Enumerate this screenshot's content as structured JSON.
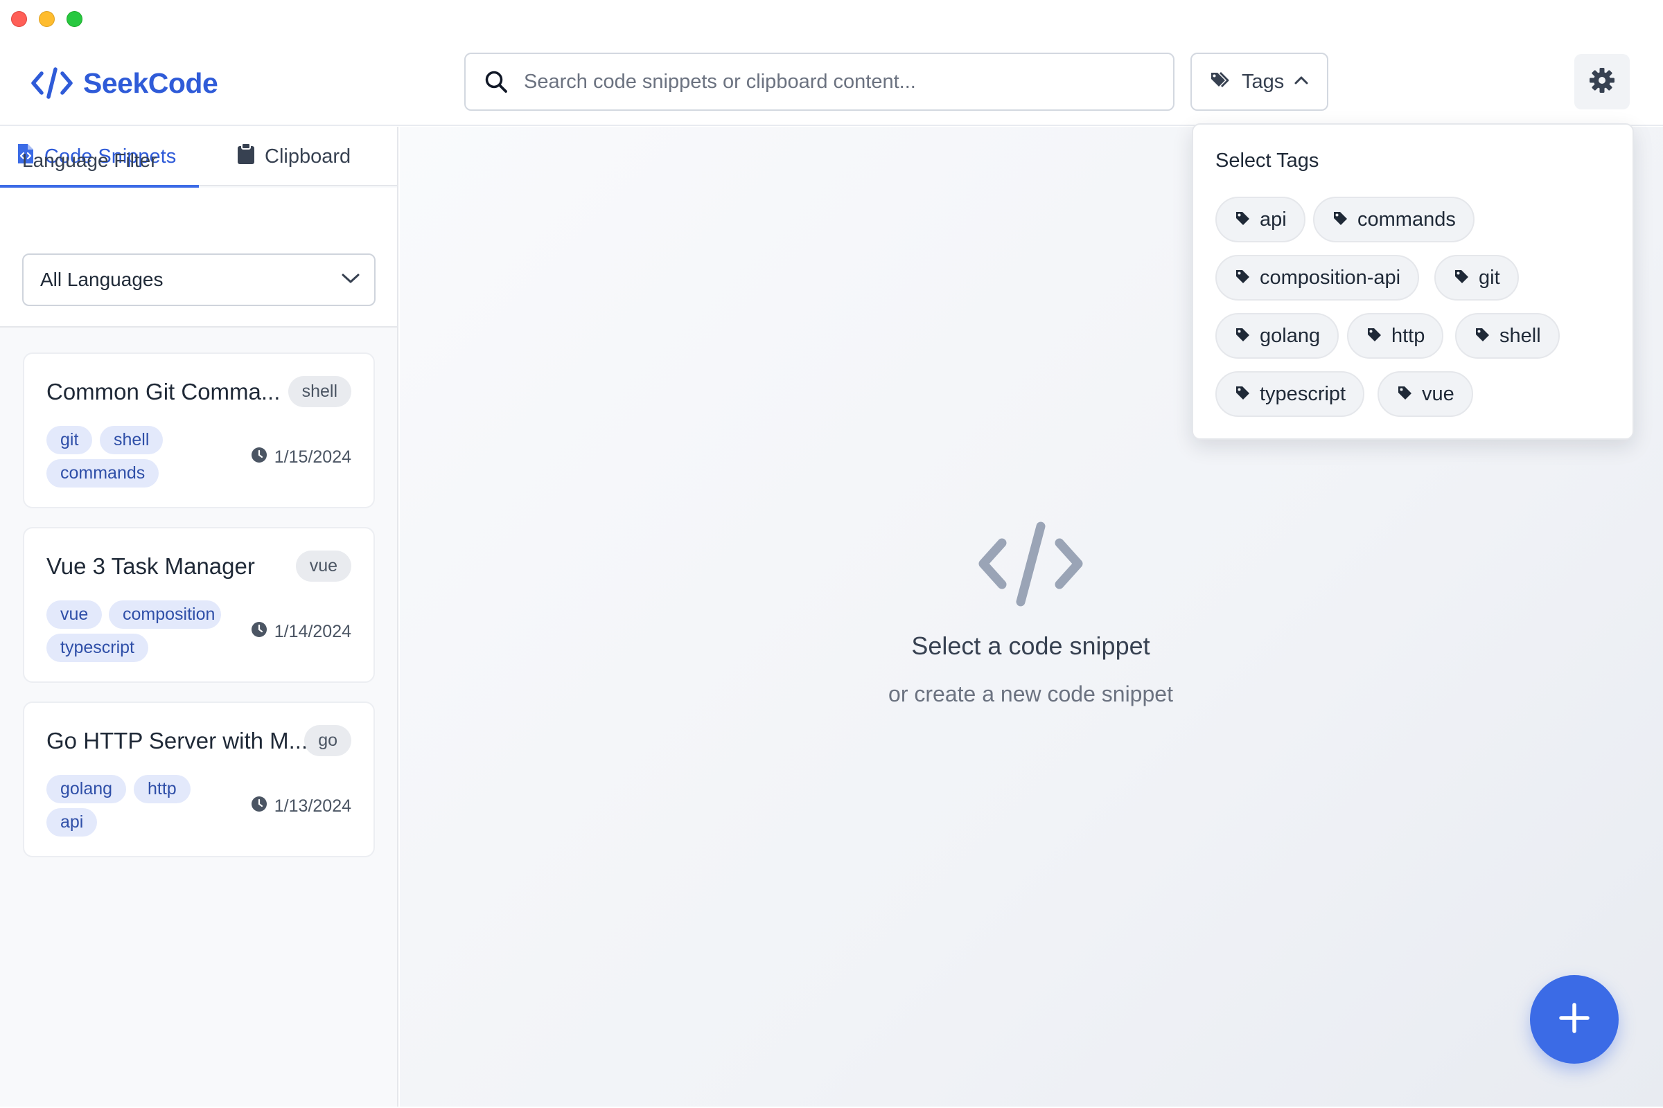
{
  "app": {
    "name": "SeekCode",
    "brand_color": "#2f5bd8",
    "accent_color": "#3b6be6"
  },
  "header": {
    "search": {
      "placeholder": "Search code snippets or clipboard content...",
      "value": "",
      "icon": "search-icon"
    },
    "tags_button": {
      "label": "Tags",
      "icon": "tags-icon",
      "state": "open"
    },
    "settings_icon": "gear-icon"
  },
  "sidebar": {
    "tabs": [
      {
        "label": "Code Snippets",
        "icon": "code-file-icon",
        "active": true
      },
      {
        "label": "Clipboard",
        "icon": "clipboard-icon",
        "active": false
      }
    ],
    "language_filter": {
      "label": "Language Filter",
      "selected": "All Languages"
    },
    "snippets": [
      {
        "title": "Common Git Comma...",
        "language": "shell",
        "tags": [
          "git",
          "shell",
          "commands"
        ],
        "date": "1/15/2024"
      },
      {
        "title": "Vue 3 Task Manager",
        "language": "vue",
        "tags": [
          "vue",
          "composition",
          "typescript"
        ],
        "date": "1/14/2024"
      },
      {
        "title": "Go HTTP Server with M...",
        "language": "go",
        "tags": [
          "golang",
          "http",
          "api"
        ],
        "date": "1/13/2024"
      }
    ]
  },
  "main": {
    "empty_state": {
      "icon": "code-icon",
      "title": "Select a code snippet",
      "subtitle": "or create a new code snippet"
    },
    "fab_icon": "plus-icon"
  },
  "tags_dropdown": {
    "heading": "Select Tags",
    "tags": [
      "api",
      "commands",
      "composition-api",
      "git",
      "golang",
      "http",
      "shell",
      "typescript",
      "vue"
    ]
  }
}
